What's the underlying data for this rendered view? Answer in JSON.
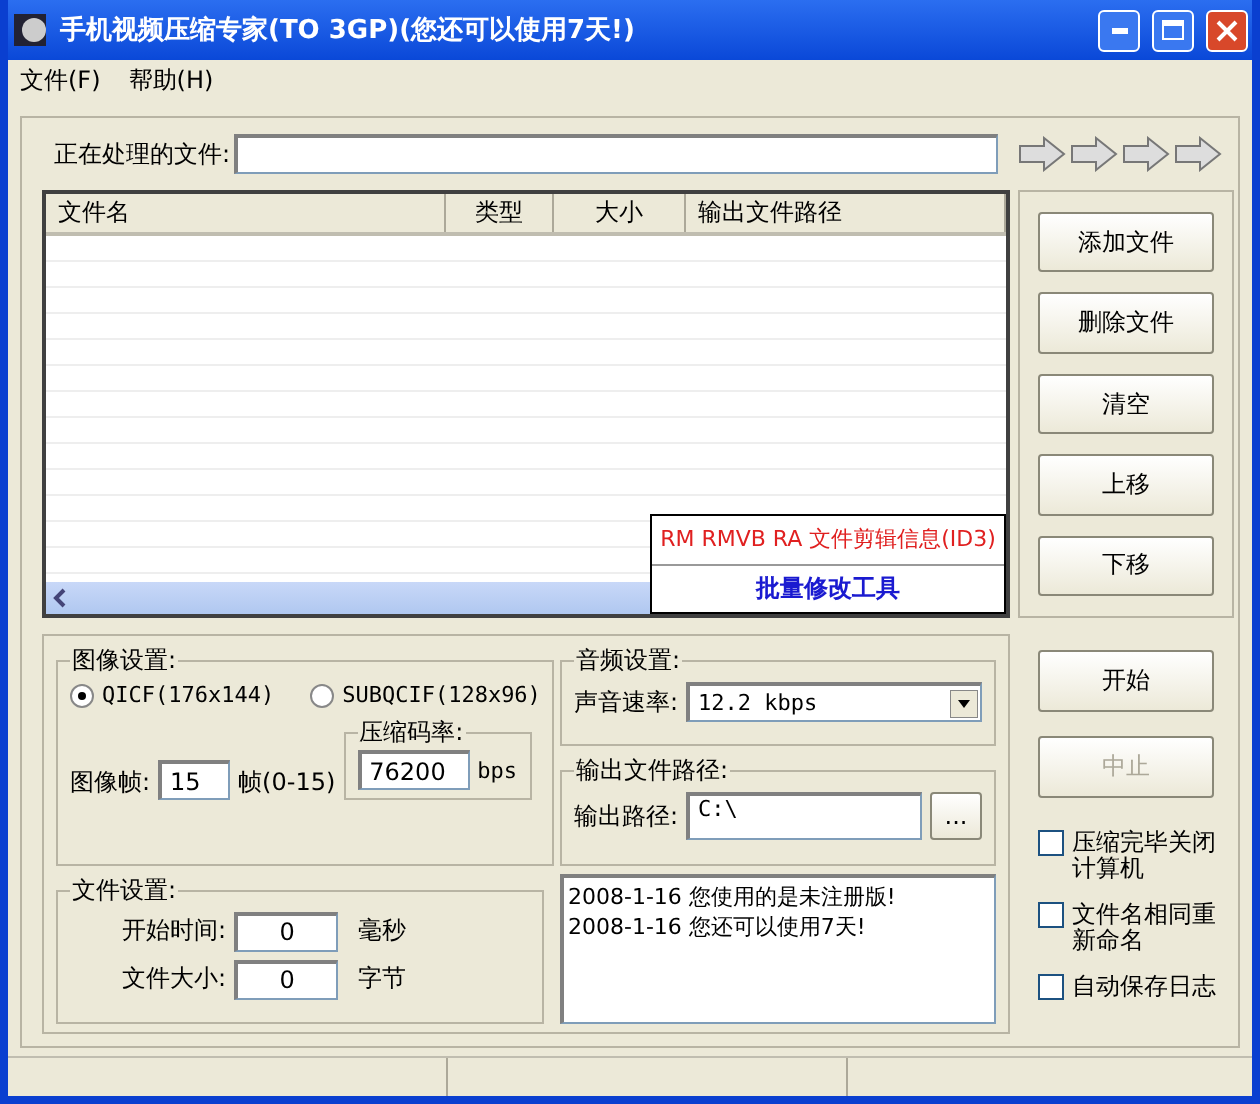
{
  "window": {
    "title": "手机视频压缩专家(TO 3GP)(您还可以使用7天!)"
  },
  "menu": [
    "文件(F)",
    "帮助(H)"
  ],
  "processing": {
    "label": "正在处理的文件:"
  },
  "table": {
    "columns": [
      "文件名",
      "类型",
      "大小",
      "输出文件路径"
    ]
  },
  "side_buttons": [
    "添加文件",
    "删除文件",
    "清空",
    "上移",
    "下移"
  ],
  "popup": {
    "lines": [
      {
        "text": "RM RMVB RA 文件剪辑信息(ID3)",
        "color": "#e02020"
      },
      {
        "text": "批量修改工具",
        "color": "#1a1ad0"
      }
    ]
  },
  "image_settings": {
    "title": "图像设置:",
    "formats": [
      {
        "label": "QICF(176x144)",
        "selected": true
      },
      {
        "label": "SUBQCIF(128x96)",
        "selected": false
      }
    ],
    "frame_label": "图像帧:",
    "frame_value": "15",
    "frame_unit": "帧(0-15)",
    "bitrate_title": "压缩码率:",
    "bitrate_value": "76200",
    "bitrate_unit": "bps"
  },
  "file_settings": {
    "title": "文件设置:",
    "fields": [
      {
        "label": "开始时间:",
        "value": "0",
        "unit": "毫秒"
      },
      {
        "label": "文件大小:",
        "value": "0",
        "unit": "字节"
      }
    ]
  },
  "audio": {
    "title": "音频设置:",
    "label": "声音速率:",
    "value": "12.2 kbps"
  },
  "output": {
    "title": "输出文件路径:",
    "label": "输出路径:",
    "value": "C:\\",
    "browse": "..."
  },
  "log": [
    "2008-1-16 您使用的是未注册版!",
    "2008-1-16 您还可以使用7天!"
  ],
  "actions": [
    {
      "label": "开始",
      "disabled": false
    },
    {
      "label": "中止",
      "disabled": true
    }
  ],
  "options": [
    {
      "label": "压缩完毕关闭计算机",
      "checked": false
    },
    {
      "label": "文件名相同重新命名",
      "checked": false
    },
    {
      "label": "自动保存日志",
      "checked": false
    }
  ]
}
